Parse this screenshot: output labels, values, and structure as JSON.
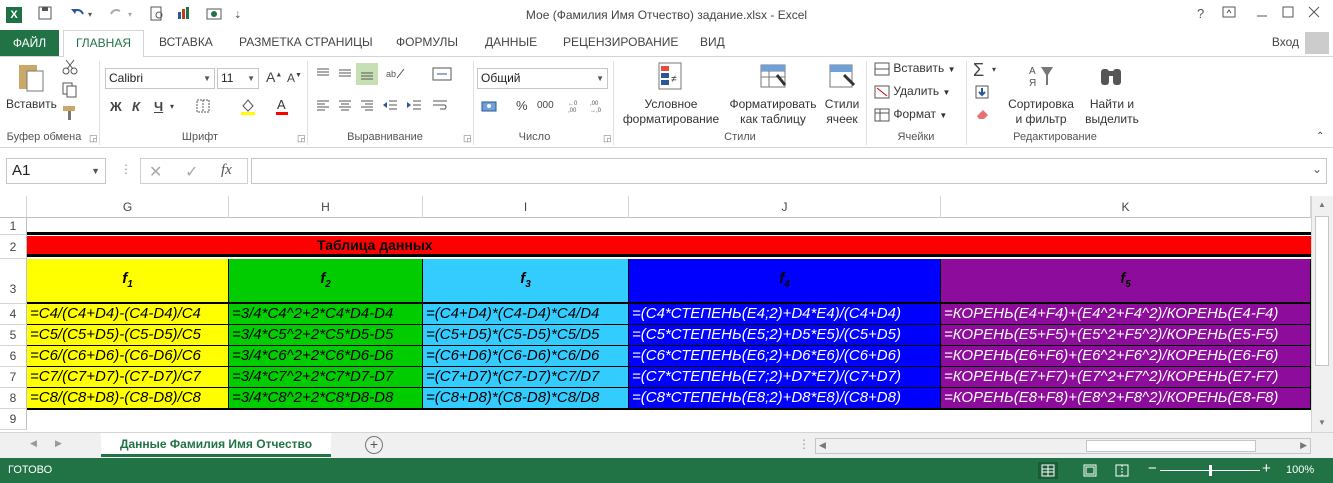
{
  "window": {
    "title": "Мое (Фамилия Имя Отчество) задание.xlsx - Excel",
    "help": "?",
    "login": "Вход"
  },
  "tabs": {
    "file": "ФАЙЛ",
    "items": [
      "ГЛАВНАЯ",
      "ВСТАВКА",
      "РАЗМЕТКА СТРАНИЦЫ",
      "ФОРМУЛЫ",
      "ДАННЫЕ",
      "РЕЦЕНЗИРОВАНИЕ",
      "ВИД"
    ]
  },
  "ribbon": {
    "paste_label": "Вставить",
    "clipboard_group": "Буфер обмена",
    "font_name": "Calibri",
    "font_size": "11",
    "font_group": "Шрифт",
    "bold": "Ж",
    "italic": "К",
    "underline": "Ч",
    "align_group": "Выравнивание",
    "number_format": "Общий",
    "number_group": "Число",
    "cond_format_1": "Условное",
    "cond_format_2": "форматирование",
    "format_table_1": "Форматировать",
    "format_table_2": "как таблицу",
    "cell_styles_1": "Стили",
    "cell_styles_2": "ячеек",
    "styles_group": "Стили",
    "insert": "Вставить",
    "delete": "Удалить",
    "format": "Формат",
    "cells_group": "Ячейки",
    "sort_1": "Сортировка",
    "sort_2": "и фильтр",
    "find_1": "Найти и",
    "find_2": "выделить",
    "editing_group": "Редактирование",
    "percent": "%",
    "thousands": "000"
  },
  "formula_bar": {
    "name_box": "A1",
    "fx": "fx",
    "formula": ""
  },
  "grid": {
    "columns": [
      "G",
      "H",
      "I",
      "J",
      "K"
    ],
    "rows": [
      "1",
      "2",
      "3",
      "4",
      "5",
      "6",
      "7",
      "8",
      "9"
    ],
    "table_title": "Таблица данных",
    "headers": [
      {
        "base": "f",
        "sub": "1"
      },
      {
        "base": "f",
        "sub": "2"
      },
      {
        "base": "f",
        "sub": "3"
      },
      {
        "base": "f",
        "sub": "4"
      },
      {
        "base": "f",
        "sub": "5"
      }
    ],
    "data": [
      [
        "=C4/(C4+D4)-(C4-D4)/C4",
        "=3/4*C4^2+2*C4*D4-D4",
        "=(C4+D4)*(C4-D4)*C4/D4",
        "=(C4*СТЕПЕНЬ(E4;2)+D4*E4)/(C4+D4)",
        "=КОРЕНЬ(E4+F4)+(E4^2+F4^2)/КОРЕНЬ(E4-F4)"
      ],
      [
        "=C5/(C5+D5)-(C5-D5)/C5",
        "=3/4*C5^2+2*C5*D5-D5",
        "=(C5+D5)*(C5-D5)*C5/D5",
        "=(C5*СТЕПЕНЬ(E5;2)+D5*E5)/(C5+D5)",
        "=КОРЕНЬ(E5+F5)+(E5^2+F5^2)/КОРЕНЬ(E5-F5)"
      ],
      [
        "=C6/(C6+D6)-(C6-D6)/C6",
        "=3/4*C6^2+2*C6*D6-D6",
        "=(C6+D6)*(C6-D6)*C6/D6",
        "=(C6*СТЕПЕНЬ(E6;2)+D6*E6)/(C6+D6)",
        "=КОРЕНЬ(E6+F6)+(E6^2+F6^2)/КОРЕНЬ(E6-F6)"
      ],
      [
        "=C7/(C7+D7)-(C7-D7)/C7",
        "=3/4*C7^2+2*C7*D7-D7",
        "=(C7+D7)*(C7-D7)*C7/D7",
        "=(C7*СТЕПЕНЬ(E7;2)+D7*E7)/(C7+D7)",
        "=КОРЕНЬ(E7+F7)+(E7^2+F7^2)/КОРЕНЬ(E7-F7)"
      ],
      [
        "=C8/(C8+D8)-(C8-D8)/C8",
        "=3/4*C8^2+2*C8*D8-D8",
        "=(C8+D8)*(C8-D8)*C8/D8",
        "=(C8*СТЕПЕНЬ(E8;2)+D8*E8)/(C8+D8)",
        "=КОРЕНЬ(E8+F8)+(E8^2+F8^2)/КОРЕНЬ(E8-F8)"
      ]
    ],
    "column_colors": [
      "#ffff00",
      "#00cc00",
      "#33ccff",
      "#0000ff",
      "#8e0c9c"
    ],
    "column_text_colors": [
      "#000000",
      "#000000",
      "#000000",
      "#ffffff",
      "#ffffff"
    ],
    "title_color": "#ff0000"
  },
  "sheet_tabs": {
    "active": "Данные Фамилия Имя Отчество"
  },
  "status": {
    "ready": "ГОТОВО",
    "zoom": "100%",
    "zoom_level": 1.0
  },
  "colors": {
    "accent": "#217346"
  }
}
